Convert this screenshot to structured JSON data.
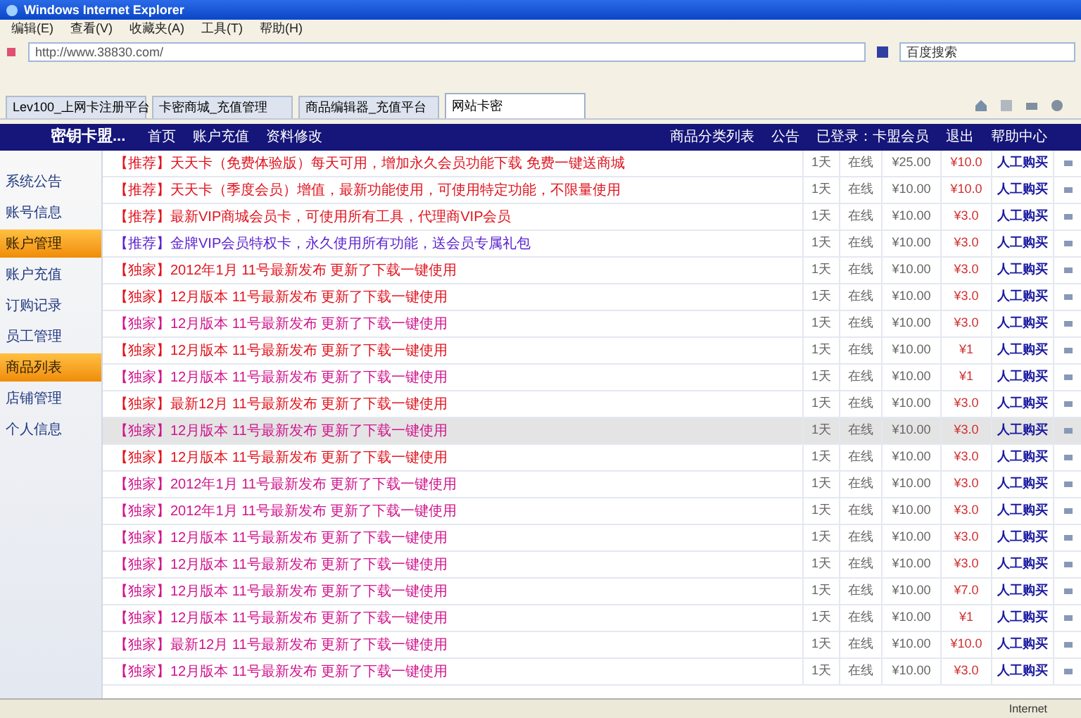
{
  "window": {
    "title": "Windows Internet Explorer"
  },
  "menu": [
    "编辑(E)",
    "查看(V)",
    "收藏夹(A)",
    "工具(T)",
    "帮助(H)"
  ],
  "address": {
    "value": "http://www.38830.com/"
  },
  "search": {
    "placeholder": "百度搜索"
  },
  "tabs": [
    {
      "label": "Lev100_上网卡注册平台",
      "selected": false
    },
    {
      "label": "卡密商城_充值管理",
      "selected": false
    },
    {
      "label": "商品编辑器_充值平台",
      "selected": false
    },
    {
      "label": "网站卡密",
      "selected": true
    }
  ],
  "header": {
    "site": "密钥卡盟...",
    "nav": [
      "首页",
      "账户充值",
      "资料修改"
    ],
    "right": [
      "商品分类列表",
      "公告",
      "已登录：卡盟会员",
      "退出",
      "帮助中心"
    ]
  },
  "sidebar": [
    {
      "label": "系统公告",
      "selected": false
    },
    {
      "label": "账号信息",
      "selected": false
    },
    {
      "label": "账户管理",
      "selected": true
    },
    {
      "label": "账户充值",
      "selected": false
    },
    {
      "label": "订购记录",
      "selected": false
    },
    {
      "label": "员工管理",
      "selected": false
    },
    {
      "label": "商品列表",
      "selected": true
    },
    {
      "label": "店铺管理",
      "selected": false
    },
    {
      "label": "个人信息",
      "selected": false
    }
  ],
  "rows": [
    {
      "title": "【推荐】天天卡（免费体验版）每天可用，增加永久会员功能下载 免费一键送商城",
      "period": "1天",
      "status": "在线",
      "price": "¥25.00",
      "discount": "¥10.0",
      "action": "人工购买",
      "color": "#e0141e",
      "selected": false
    },
    {
      "title": "【推荐】天天卡（季度会员）增值，最新功能使用，可使用特定功能，不限量使用",
      "period": "1天",
      "status": "在线",
      "price": "¥10.00",
      "discount": "¥10.0",
      "action": "人工购买",
      "color": "#e0141e",
      "selected": false
    },
    {
      "title": "【推荐】最新VIP商城会员卡，可使用所有工具，代理商VIP会员",
      "period": "1天",
      "status": "在线",
      "price": "¥10.00",
      "discount": "¥3.0",
      "action": "人工购买",
      "color": "#e0141e",
      "selected": false
    },
    {
      "title": "【推荐】金牌VIP会员特权卡，永久使用所有功能，送会员专属礼包",
      "period": "1天",
      "status": "在线",
      "price": "¥10.00",
      "discount": "¥3.0",
      "action": "人工购买",
      "color": "#5a1fd0",
      "selected": false
    },
    {
      "title": "【独家】2012年1月 11号最新发布 更新了下载一键使用",
      "period": "1天",
      "status": "在线",
      "price": "¥10.00",
      "discount": "¥3.0",
      "action": "人工购买",
      "color": "#e0141e",
      "selected": false
    },
    {
      "title": "【独家】12月版本 11号最新发布 更新了下载一键使用",
      "period": "1天",
      "status": "在线",
      "price": "¥10.00",
      "discount": "¥3.0",
      "action": "人工购买",
      "color": "#e0141e",
      "selected": false
    },
    {
      "title": "【独家】12月版本 11号最新发布 更新了下载一键使用",
      "period": "1天",
      "status": "在线",
      "price": "¥10.00",
      "discount": "¥3.0",
      "action": "人工购买",
      "color": "#d0148c",
      "selected": false
    },
    {
      "title": "【独家】12月版本 11号最新发布 更新了下载一键使用",
      "period": "1天",
      "status": "在线",
      "price": "¥10.00",
      "discount": "¥1",
      "action": "人工购买",
      "color": "#e0141e",
      "selected": false
    },
    {
      "title": "【独家】12月版本 11号最新发布 更新了下载一键使用",
      "period": "1天",
      "status": "在线",
      "price": "¥10.00",
      "discount": "¥1",
      "action": "人工购买",
      "color": "#d0148c",
      "selected": false
    },
    {
      "title": "【独家】最新12月 11号最新发布 更新了下载一键使用",
      "period": "1天",
      "status": "在线",
      "price": "¥10.00",
      "discount": "¥3.0",
      "action": "人工购买",
      "color": "#e0141e",
      "selected": false
    },
    {
      "title": "【独家】12月版本 11号最新发布 更新了下载一键使用",
      "period": "1天",
      "status": "在线",
      "price": "¥10.00",
      "discount": "¥3.0",
      "action": "人工购买",
      "color": "#d0148c",
      "selected": true
    },
    {
      "title": "【独家】12月版本 11号最新发布 更新了下载一键使用",
      "period": "1天",
      "status": "在线",
      "price": "¥10.00",
      "discount": "¥3.0",
      "action": "人工购买",
      "color": "#e0141e",
      "selected": false
    },
    {
      "title": "【独家】2012年1月 11号最新发布 更新了下载一键使用",
      "period": "1天",
      "status": "在线",
      "price": "¥10.00",
      "discount": "¥3.0",
      "action": "人工购买",
      "color": "#d0148c",
      "selected": false
    },
    {
      "title": "【独家】2012年1月 11号最新发布 更新了下载一键使用",
      "period": "1天",
      "status": "在线",
      "price": "¥10.00",
      "discount": "¥3.0",
      "action": "人工购买",
      "color": "#d0148c",
      "selected": false
    },
    {
      "title": "【独家】12月版本 11号最新发布 更新了下载一键使用",
      "period": "1天",
      "status": "在线",
      "price": "¥10.00",
      "discount": "¥3.0",
      "action": "人工购买",
      "color": "#d0148c",
      "selected": false
    },
    {
      "title": "【独家】12月版本 11号最新发布 更新了下载一键使用",
      "period": "1天",
      "status": "在线",
      "price": "¥10.00",
      "discount": "¥3.0",
      "action": "人工购买",
      "color": "#d0148c",
      "selected": false
    },
    {
      "title": "【独家】12月版本 11号最新发布 更新了下载一键使用",
      "period": "1天",
      "status": "在线",
      "price": "¥10.00",
      "discount": "¥7.0",
      "action": "人工购买",
      "color": "#d0148c",
      "selected": false
    },
    {
      "title": "【独家】12月版本 11号最新发布 更新了下载一键使用",
      "period": "1天",
      "status": "在线",
      "price": "¥10.00",
      "discount": "¥1",
      "action": "人工购买",
      "color": "#d0148c",
      "selected": false
    },
    {
      "title": "【独家】最新12月 11号最新发布 更新了下载一键使用",
      "period": "1天",
      "status": "在线",
      "price": "¥10.00",
      "discount": "¥10.0",
      "action": "人工购买",
      "color": "#d0148c",
      "selected": false
    },
    {
      "title": "【独家】12月版本 11号最新发布 更新了下载一键使用",
      "period": "1天",
      "status": "在线",
      "price": "¥10.00",
      "discount": "¥3.0",
      "action": "人工购买",
      "color": "#d0148c",
      "selected": false
    }
  ],
  "status_bar": {
    "zone": "Internet"
  }
}
